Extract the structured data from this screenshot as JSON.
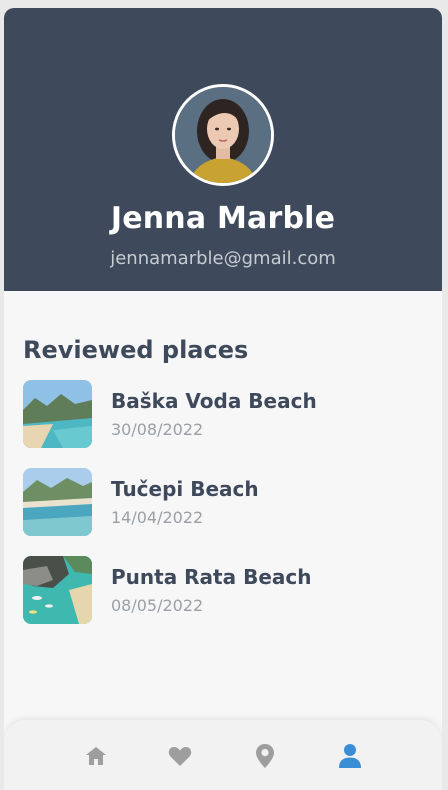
{
  "profile": {
    "name": "Jenna Marble",
    "email": "jennamarble@gmail.com"
  },
  "reviews": {
    "title": "Reviewed places",
    "items": [
      {
        "name": "Baška Voda Beach",
        "date": "30/08/2022"
      },
      {
        "name": "Tučepi Beach",
        "date": "14/04/2022"
      },
      {
        "name": "Punta Rata Beach",
        "date": "08/05/2022"
      }
    ]
  },
  "nav": {
    "items": [
      {
        "icon": "home-icon",
        "active": false
      },
      {
        "icon": "heart-icon",
        "active": false
      },
      {
        "icon": "location-pin-icon",
        "active": false
      },
      {
        "icon": "user-icon",
        "active": true
      }
    ]
  },
  "colors": {
    "header": "#3e4a5b",
    "active": "#3b8ed6",
    "inactive": "#9e9e9e"
  }
}
